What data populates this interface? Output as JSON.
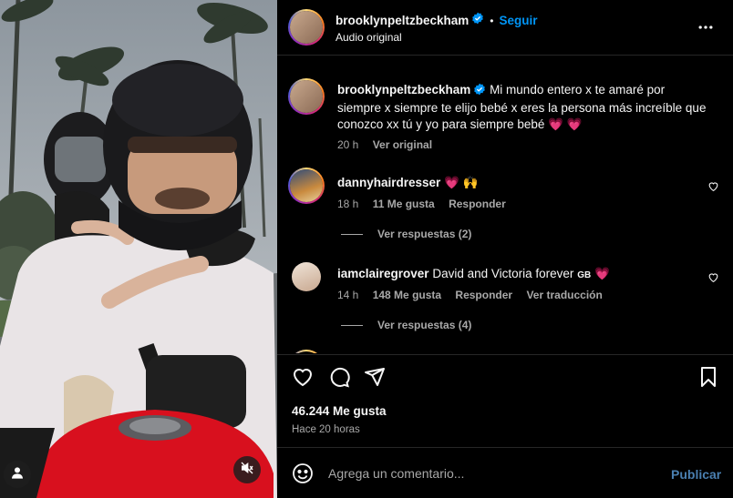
{
  "post": {
    "username": "brooklynpeltzbeckham",
    "follow_label": "Seguir",
    "separator": "•",
    "audio_label": "Audio original"
  },
  "caption": {
    "username": "brooklynpeltzbeckham",
    "text": "Mi mundo entero x te amaré por siempre x siempre te elijo bebé x eres la persona más increíble que conozco xx tú y yo para siempre bebé",
    "hearts": "💗 💗",
    "time": "20 h",
    "see_original": "Ver original"
  },
  "comments": [
    {
      "username": "dannyhairdresser",
      "text": "💗 🙌",
      "time": "18 h",
      "likes": "11 Me gusta",
      "reply": "Responder",
      "view_replies": "Ver respuestas (2)"
    },
    {
      "username": "iamclairegrover",
      "text": "David and Victoria forever",
      "flag": "GB",
      "heart": "💗",
      "time": "14 h",
      "likes": "148 Me gusta",
      "reply": "Responder",
      "translate": "Ver traducción",
      "view_replies": "Ver respuestas (4)"
    }
  ],
  "actions": {
    "like_count": "46.244 Me gusta",
    "posted": "Hace 20 horas"
  },
  "composer": {
    "placeholder": "Agrega un comentario...",
    "publish_label": "Publicar"
  },
  "icons": {
    "more": "more-horizontal-icon",
    "verified": "verified-badge-icon",
    "like": "heart-icon",
    "comment": "comment-icon",
    "share": "share-icon",
    "save": "bookmark-icon",
    "emoji": "emoji-icon",
    "tag": "user-tag-icon",
    "mute": "sound-off-icon"
  },
  "colors": {
    "accent": "#0095f6",
    "publish_disabled": "#4a7fb0",
    "secondary_text": "#a8a8a8",
    "divider": "#262626",
    "verified": "#0095f6",
    "heart_emoji": "#ff3b6b"
  }
}
